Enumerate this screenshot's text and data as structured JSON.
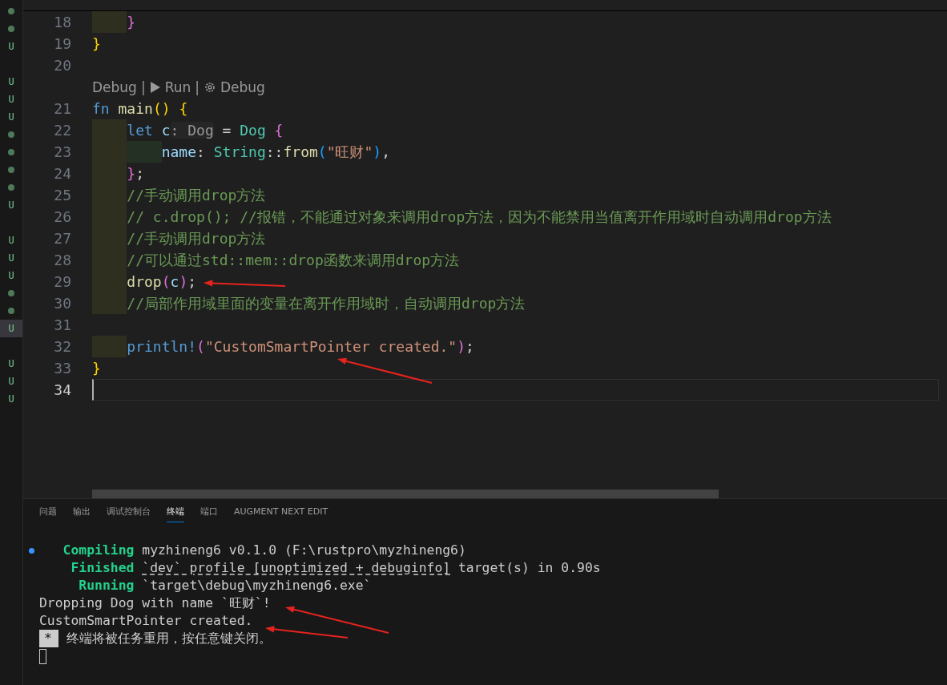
{
  "gutter_markers": [
    {
      "kind": "dot",
      "selected": false
    },
    {
      "kind": "dot",
      "selected": false
    },
    {
      "kind": "letter",
      "text": "U",
      "selected": false
    },
    {
      "kind": "blank",
      "selected": false
    },
    {
      "kind": "letter",
      "text": "U",
      "selected": false
    },
    {
      "kind": "letter",
      "text": "U",
      "selected": false
    },
    {
      "kind": "letter",
      "text": "U",
      "selected": false
    },
    {
      "kind": "dot",
      "selected": false
    },
    {
      "kind": "dot",
      "selected": false
    },
    {
      "kind": "dot",
      "selected": false
    },
    {
      "kind": "dot",
      "selected": false
    },
    {
      "kind": "letter",
      "text": "U",
      "selected": false
    },
    {
      "kind": "blank",
      "selected": false
    },
    {
      "kind": "letter",
      "text": "U",
      "selected": false
    },
    {
      "kind": "letter",
      "text": "U",
      "selected": false
    },
    {
      "kind": "letter",
      "text": "U",
      "selected": false
    },
    {
      "kind": "dot",
      "selected": false
    },
    {
      "kind": "dot",
      "selected": false
    },
    {
      "kind": "letter",
      "text": "U",
      "selected": true
    },
    {
      "kind": "blank",
      "selected": false
    },
    {
      "kind": "letter",
      "text": "U",
      "selected": false
    },
    {
      "kind": "letter",
      "text": "U",
      "selected": false
    },
    {
      "kind": "letter",
      "text": "U",
      "selected": false
    }
  ],
  "editor": {
    "lines": [
      {
        "kind": "code",
        "number": "18",
        "current": false,
        "tokens": [
          {
            "kind": "indent"
          },
          {
            "kind": "brace2",
            "text": "}"
          }
        ]
      },
      {
        "kind": "code",
        "number": "19",
        "current": false,
        "tokens": [
          {
            "kind": "brace1",
            "text": "}"
          }
        ]
      },
      {
        "kind": "code",
        "number": "20",
        "current": false
      },
      {
        "kind": "codelens",
        "items": [
          {
            "kind": "link",
            "text": "Debug"
          },
          {
            "kind": "separator",
            "text": "|"
          },
          {
            "kind": "run",
            "text": "Run"
          },
          {
            "kind": "separator",
            "text": "|"
          },
          {
            "kind": "gear",
            "text": "Debug"
          }
        ]
      },
      {
        "kind": "code",
        "number": "21",
        "current": false,
        "tokens": [
          {
            "kind": "keyword",
            "text": "fn"
          },
          {
            "kind": "function",
            "text": " main"
          },
          {
            "kind": "brace1",
            "text": "()"
          },
          {
            "kind": "brace1",
            "text": " {"
          }
        ]
      },
      {
        "kind": "code",
        "number": "22",
        "current": false,
        "tokens": [
          {
            "kind": "indent"
          },
          {
            "kind": "keyword",
            "text": "let"
          },
          {
            "kind": "variable",
            "text": " c"
          },
          {
            "kind": "hint",
            "text": ": Dog"
          },
          {
            "kind": "plain",
            "text": " = "
          },
          {
            "kind": "type",
            "text": "Dog"
          },
          {
            "kind": "brace2",
            "text": " {"
          }
        ]
      },
      {
        "kind": "code",
        "number": "23",
        "current": false,
        "tokens": [
          {
            "kind": "indent"
          },
          {
            "kind": "indent"
          },
          {
            "kind": "variable",
            "text": "name"
          },
          {
            "kind": "plain",
            "text": ": "
          },
          {
            "kind": "type",
            "text": "String"
          },
          {
            "kind": "plain",
            "text": "::"
          },
          {
            "kind": "function",
            "text": "from"
          },
          {
            "kind": "brace3",
            "text": "("
          },
          {
            "kind": "string",
            "text": "\"旺财\""
          },
          {
            "kind": "brace3",
            "text": ")"
          },
          {
            "kind": "plain",
            "text": ","
          }
        ]
      },
      {
        "kind": "code",
        "number": "24",
        "current": false,
        "tokens": [
          {
            "kind": "indent"
          },
          {
            "kind": "brace2",
            "text": "}"
          },
          {
            "kind": "plain",
            "text": ";"
          }
        ]
      },
      {
        "kind": "code",
        "number": "25",
        "current": false,
        "tokens": [
          {
            "kind": "indent"
          },
          {
            "kind": "comment",
            "text": "//手动调用drop方法"
          }
        ]
      },
      {
        "kind": "code",
        "number": "26",
        "current": false,
        "tokens": [
          {
            "kind": "indent"
          },
          {
            "kind": "comment",
            "text": "// c.drop(); //报错，不能通过对象来调用drop方法，因为不能禁用当值离开作用域时自动调用drop方法"
          }
        ]
      },
      {
        "kind": "code",
        "number": "27",
        "current": false,
        "tokens": [
          {
            "kind": "indent"
          },
          {
            "kind": "comment",
            "text": "//手动调用drop方法"
          }
        ]
      },
      {
        "kind": "code",
        "number": "28",
        "current": false,
        "tokens": [
          {
            "kind": "indent"
          },
          {
            "kind": "comment",
            "text": "//可以通过std::mem::drop函数来调用drop方法"
          }
        ]
      },
      {
        "kind": "code",
        "number": "29",
        "current": false,
        "tokens": [
          {
            "kind": "indent"
          },
          {
            "kind": "function",
            "text": "drop"
          },
          {
            "kind": "brace2",
            "text": "("
          },
          {
            "kind": "variable",
            "text": "c"
          },
          {
            "kind": "brace2",
            "text": ")"
          },
          {
            "kind": "plain",
            "text": ";"
          }
        ]
      },
      {
        "kind": "code",
        "number": "30",
        "current": false,
        "tokens": [
          {
            "kind": "indent"
          },
          {
            "kind": "comment",
            "text": "//局部作用域里面的变量在离开作用域时，自动调用drop方法"
          }
        ]
      },
      {
        "kind": "code",
        "number": "31",
        "current": false
      },
      {
        "kind": "code",
        "number": "32",
        "current": false,
        "tokens": [
          {
            "kind": "indent"
          },
          {
            "kind": "keyword",
            "text": "println!"
          },
          {
            "kind": "brace2",
            "text": "("
          },
          {
            "kind": "string",
            "text": "\"CustomSmartPointer created.\""
          },
          {
            "kind": "brace2",
            "text": ")"
          },
          {
            "kind": "plain",
            "text": ";"
          }
        ]
      },
      {
        "kind": "code",
        "number": "33",
        "current": false,
        "tokens": [
          {
            "kind": "brace1",
            "text": "}"
          }
        ]
      },
      {
        "kind": "code",
        "number": "34",
        "current": true
      }
    ]
  },
  "annotations": [
    {
      "kind": "arrow"
    },
    {
      "kind": "arrow"
    },
    {
      "kind": "arrow"
    },
    {
      "kind": "arrow"
    }
  ],
  "panel": {
    "tabs": [
      {
        "label": "问题",
        "selected": false
      },
      {
        "label": "输出",
        "selected": false
      },
      {
        "label": "调试控制台",
        "selected": false
      },
      {
        "label": "终端",
        "selected": true
      },
      {
        "label": "端口",
        "selected": false
      },
      {
        "label": "AUGMENT NEXT EDIT",
        "selected": false
      }
    ],
    "terminal": [
      {
        "kind": "status",
        "marker": true,
        "status": "Compiling",
        "parts": [
          {
            "kind": "plain",
            "text": "myzhineng6 v0.1.0 (F:\\rustpro\\myzhineng6)"
          }
        ]
      },
      {
        "kind": "status",
        "marker": false,
        "status": "Finished",
        "parts": [
          {
            "kind": "link",
            "text": "`dev` profile [unoptimized + debuginfo]"
          },
          {
            "kind": "plain",
            "text": " target(s) in 0.90s"
          }
        ]
      },
      {
        "kind": "status",
        "marker": false,
        "status": "Running",
        "parts": [
          {
            "kind": "plain",
            "text": "`target\\debug\\myzhineng6.exe`"
          }
        ]
      },
      {
        "kind": "output",
        "text": "Dropping Dog with name `旺财`!"
      },
      {
        "kind": "output",
        "text": "CustomSmartPointer created."
      },
      {
        "kind": "notice",
        "badge": "*",
        "text": "终端将被任务重用，按任意键关闭。"
      },
      {
        "kind": "cursor"
      }
    ]
  }
}
